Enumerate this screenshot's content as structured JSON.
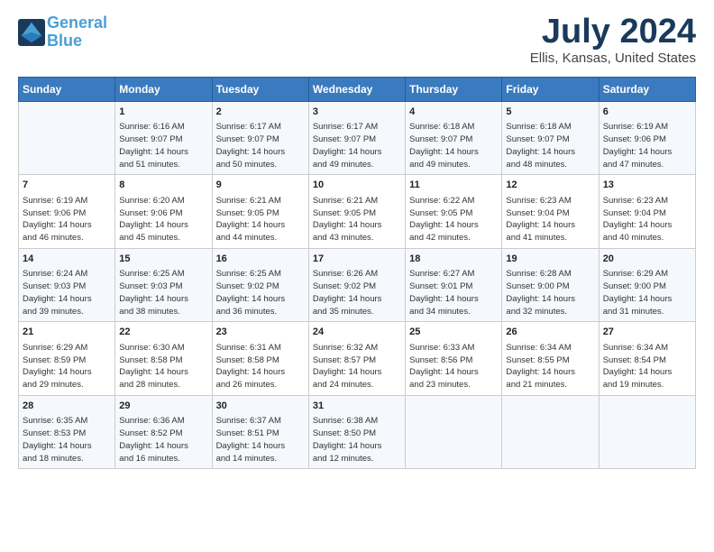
{
  "header": {
    "logo_line1": "General",
    "logo_line2": "Blue",
    "month": "July 2024",
    "location": "Ellis, Kansas, United States"
  },
  "weekdays": [
    "Sunday",
    "Monday",
    "Tuesday",
    "Wednesday",
    "Thursday",
    "Friday",
    "Saturday"
  ],
  "weeks": [
    [
      {
        "day": "",
        "info": ""
      },
      {
        "day": "1",
        "info": "Sunrise: 6:16 AM\nSunset: 9:07 PM\nDaylight: 14 hours\nand 51 minutes."
      },
      {
        "day": "2",
        "info": "Sunrise: 6:17 AM\nSunset: 9:07 PM\nDaylight: 14 hours\nand 50 minutes."
      },
      {
        "day": "3",
        "info": "Sunrise: 6:17 AM\nSunset: 9:07 PM\nDaylight: 14 hours\nand 49 minutes."
      },
      {
        "day": "4",
        "info": "Sunrise: 6:18 AM\nSunset: 9:07 PM\nDaylight: 14 hours\nand 49 minutes."
      },
      {
        "day": "5",
        "info": "Sunrise: 6:18 AM\nSunset: 9:07 PM\nDaylight: 14 hours\nand 48 minutes."
      },
      {
        "day": "6",
        "info": "Sunrise: 6:19 AM\nSunset: 9:06 PM\nDaylight: 14 hours\nand 47 minutes."
      }
    ],
    [
      {
        "day": "7",
        "info": "Sunrise: 6:19 AM\nSunset: 9:06 PM\nDaylight: 14 hours\nand 46 minutes."
      },
      {
        "day": "8",
        "info": "Sunrise: 6:20 AM\nSunset: 9:06 PM\nDaylight: 14 hours\nand 45 minutes."
      },
      {
        "day": "9",
        "info": "Sunrise: 6:21 AM\nSunset: 9:05 PM\nDaylight: 14 hours\nand 44 minutes."
      },
      {
        "day": "10",
        "info": "Sunrise: 6:21 AM\nSunset: 9:05 PM\nDaylight: 14 hours\nand 43 minutes."
      },
      {
        "day": "11",
        "info": "Sunrise: 6:22 AM\nSunset: 9:05 PM\nDaylight: 14 hours\nand 42 minutes."
      },
      {
        "day": "12",
        "info": "Sunrise: 6:23 AM\nSunset: 9:04 PM\nDaylight: 14 hours\nand 41 minutes."
      },
      {
        "day": "13",
        "info": "Sunrise: 6:23 AM\nSunset: 9:04 PM\nDaylight: 14 hours\nand 40 minutes."
      }
    ],
    [
      {
        "day": "14",
        "info": "Sunrise: 6:24 AM\nSunset: 9:03 PM\nDaylight: 14 hours\nand 39 minutes."
      },
      {
        "day": "15",
        "info": "Sunrise: 6:25 AM\nSunset: 9:03 PM\nDaylight: 14 hours\nand 38 minutes."
      },
      {
        "day": "16",
        "info": "Sunrise: 6:25 AM\nSunset: 9:02 PM\nDaylight: 14 hours\nand 36 minutes."
      },
      {
        "day": "17",
        "info": "Sunrise: 6:26 AM\nSunset: 9:02 PM\nDaylight: 14 hours\nand 35 minutes."
      },
      {
        "day": "18",
        "info": "Sunrise: 6:27 AM\nSunset: 9:01 PM\nDaylight: 14 hours\nand 34 minutes."
      },
      {
        "day": "19",
        "info": "Sunrise: 6:28 AM\nSunset: 9:00 PM\nDaylight: 14 hours\nand 32 minutes."
      },
      {
        "day": "20",
        "info": "Sunrise: 6:29 AM\nSunset: 9:00 PM\nDaylight: 14 hours\nand 31 minutes."
      }
    ],
    [
      {
        "day": "21",
        "info": "Sunrise: 6:29 AM\nSunset: 8:59 PM\nDaylight: 14 hours\nand 29 minutes."
      },
      {
        "day": "22",
        "info": "Sunrise: 6:30 AM\nSunset: 8:58 PM\nDaylight: 14 hours\nand 28 minutes."
      },
      {
        "day": "23",
        "info": "Sunrise: 6:31 AM\nSunset: 8:58 PM\nDaylight: 14 hours\nand 26 minutes."
      },
      {
        "day": "24",
        "info": "Sunrise: 6:32 AM\nSunset: 8:57 PM\nDaylight: 14 hours\nand 24 minutes."
      },
      {
        "day": "25",
        "info": "Sunrise: 6:33 AM\nSunset: 8:56 PM\nDaylight: 14 hours\nand 23 minutes."
      },
      {
        "day": "26",
        "info": "Sunrise: 6:34 AM\nSunset: 8:55 PM\nDaylight: 14 hours\nand 21 minutes."
      },
      {
        "day": "27",
        "info": "Sunrise: 6:34 AM\nSunset: 8:54 PM\nDaylight: 14 hours\nand 19 minutes."
      }
    ],
    [
      {
        "day": "28",
        "info": "Sunrise: 6:35 AM\nSunset: 8:53 PM\nDaylight: 14 hours\nand 18 minutes."
      },
      {
        "day": "29",
        "info": "Sunrise: 6:36 AM\nSunset: 8:52 PM\nDaylight: 14 hours\nand 16 minutes."
      },
      {
        "day": "30",
        "info": "Sunrise: 6:37 AM\nSunset: 8:51 PM\nDaylight: 14 hours\nand 14 minutes."
      },
      {
        "day": "31",
        "info": "Sunrise: 6:38 AM\nSunset: 8:50 PM\nDaylight: 14 hours\nand 12 minutes."
      },
      {
        "day": "",
        "info": ""
      },
      {
        "day": "",
        "info": ""
      },
      {
        "day": "",
        "info": ""
      }
    ]
  ]
}
